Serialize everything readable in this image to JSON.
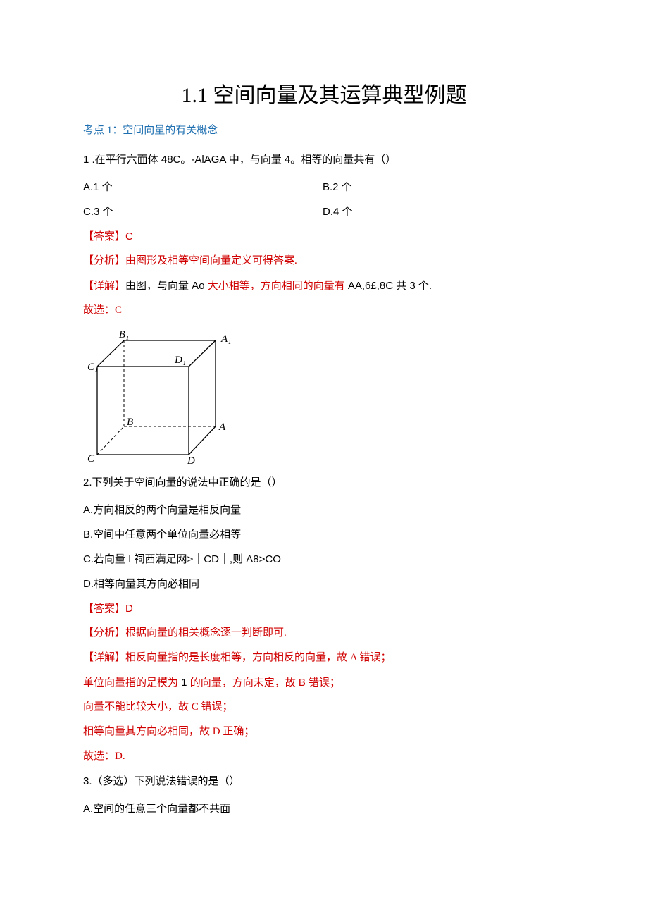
{
  "title": "1.1 空间向量及其运算典型例题",
  "topic1": "考点 1：空间向量的有关概念",
  "q1": {
    "stem": "1 .在平行六面体 48C。-AlAGA 中，与向量 4。相等的向量共有（）",
    "A": "A.1 个",
    "B": "B.2 个",
    "C": "C.3 个",
    "D": "D.4 个",
    "answer": "【答案】C",
    "analysis": "【分析】由图形及相等空间向量定义可得答案.",
    "detail_prefix": "【详解】",
    "detail_black": "由图，与向量 Ao ",
    "detail_red_mid": "大小相等，方向相同的向量有 ",
    "detail_tail": "AA,6£,8C 共 3 个.",
    "choose": "故选：C"
  },
  "figure": {
    "B1": "B₁",
    "A1": "A₁",
    "C1": "C₁",
    "D1": "D₁",
    "B": "B",
    "A": "A",
    "C": "C",
    "D": "D"
  },
  "q2": {
    "stem": "2.下列关于空间向量的说法中正确的是（）",
    "A": "A.方向相反的两个向量是相反向量",
    "B": "B.空间中任意两个单位向量必相等",
    "C": "C.若向量 I 祠西满足网>｜CD｜,则 A8>CO",
    "D": "D.相等向量其方向必相同",
    "answer": "【答案】D",
    "analysis": "【分析】根据向量的相关概念逐一判断即可.",
    "dA": "【详解】相反向量指的是长度相等，方向相反的向量，故 A 错误；",
    "dB_pre": "单位向量指的是模为 ",
    "dB_num": "1 ",
    "dB_post": "的向量，方向未定，故 B 错误；",
    "dC": "向量不能比较大小，故 C 错误；",
    "dD": "相等向量其方向必相同，故 D 正确；",
    "choose": "故选：D."
  },
  "q3": {
    "stem": "3.（多选）下列说法错误的是（）",
    "A": "A.空间的任意三个向量都不共面"
  }
}
